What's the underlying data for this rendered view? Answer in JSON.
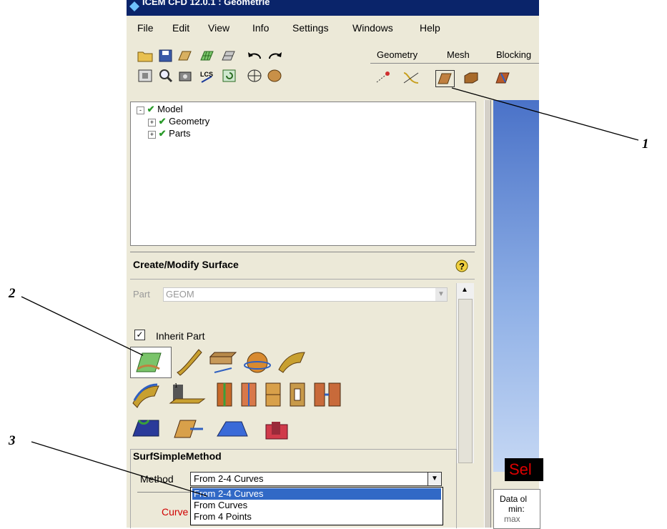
{
  "window": {
    "title": "ICEM CFD 12.0.1 : Geometrie"
  },
  "menu": [
    "File",
    "Edit",
    "View",
    "Info",
    "Settings",
    "Windows",
    "Help"
  ],
  "tabs": [
    "Geometry",
    "Mesh",
    "Blocking"
  ],
  "tree": {
    "root": "Model",
    "children": [
      "Geometry",
      "Parts"
    ]
  },
  "panel": {
    "title": "Create/Modify Surface",
    "part_label": "Part",
    "part_value": "GEOM",
    "inherit_label": "Inherit Part",
    "inherit_checked": true,
    "group_title": "SurfSimpleMethod",
    "method_label": "Method",
    "method_value": "From 2-4 Curves",
    "method_options": [
      "From 2-4 Curves",
      "From Curves",
      "From 4 Points"
    ],
    "curves_label": "Curve"
  },
  "viewer": {
    "status_text": "Sel",
    "data_lines": [
      "Data ol",
      "min:",
      "max"
    ]
  },
  "callouts": [
    "1",
    "2",
    "3"
  ],
  "colors": {
    "titlebar": "#0a246a",
    "selection": "#3169c6",
    "status_red": "#d00000"
  },
  "icons": [
    "open-folder-icon",
    "save-icon",
    "geometry-icon",
    "mesh-icon",
    "blocking-icon",
    "undo-icon",
    "redo-icon",
    "fit-icon",
    "zoom-icon",
    "measure-icon",
    "lcs-icon",
    "refresh-icon",
    "wireframe-icon",
    "solid-icon",
    "create-point-icon",
    "create-curve-icon",
    "create-surface-icon",
    "create-body-icon",
    "repair-icon"
  ]
}
